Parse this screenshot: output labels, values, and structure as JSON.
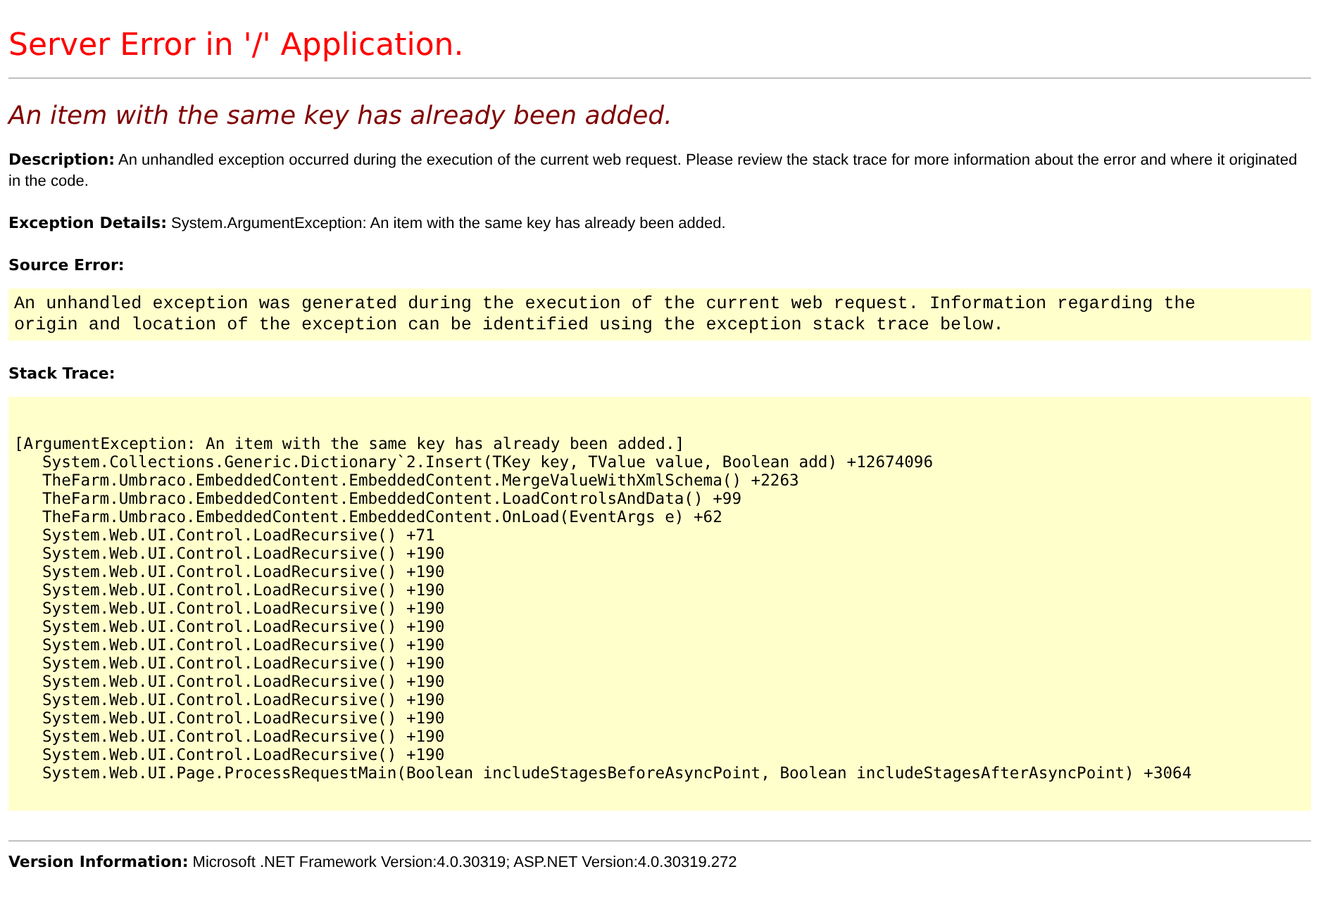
{
  "title": "Server Error in '/' Application.",
  "error_message": "An item with the same key has already been added.",
  "description": {
    "label": "Description:",
    "text": "An unhandled exception occurred during the execution of the current web request. Please review the stack trace for more information about the error and where it originated in the code."
  },
  "exception_details": {
    "label": "Exception Details:",
    "text": "System.ArgumentException: An item with the same key has already been added."
  },
  "source_error": {
    "label": "Source Error:",
    "lines": [
      "An unhandled exception was generated during the execution of the current web request. Information regarding the",
      "origin and location of the exception can be identified using the exception stack trace below."
    ]
  },
  "stack_trace": {
    "label": "Stack Trace:",
    "lines": [
      {
        "text": "[ArgumentException: An item with the same key has already been added.]",
        "indented": false
      },
      {
        "text": "System.Collections.Generic.Dictionary`2.Insert(TKey key, TValue value, Boolean add) +12674096",
        "indented": true
      },
      {
        "text": "TheFarm.Umbraco.EmbeddedContent.EmbeddedContent.MergeValueWithXmlSchema() +2263",
        "indented": true
      },
      {
        "text": "TheFarm.Umbraco.EmbeddedContent.EmbeddedContent.LoadControlsAndData() +99",
        "indented": true
      },
      {
        "text": "TheFarm.Umbraco.EmbeddedContent.EmbeddedContent.OnLoad(EventArgs e) +62",
        "indented": true
      },
      {
        "text": "System.Web.UI.Control.LoadRecursive() +71",
        "indented": true
      },
      {
        "text": "System.Web.UI.Control.LoadRecursive() +190",
        "indented": true
      },
      {
        "text": "System.Web.UI.Control.LoadRecursive() +190",
        "indented": true
      },
      {
        "text": "System.Web.UI.Control.LoadRecursive() +190",
        "indented": true
      },
      {
        "text": "System.Web.UI.Control.LoadRecursive() +190",
        "indented": true
      },
      {
        "text": "System.Web.UI.Control.LoadRecursive() +190",
        "indented": true
      },
      {
        "text": "System.Web.UI.Control.LoadRecursive() +190",
        "indented": true
      },
      {
        "text": "System.Web.UI.Control.LoadRecursive() +190",
        "indented": true
      },
      {
        "text": "System.Web.UI.Control.LoadRecursive() +190",
        "indented": true
      },
      {
        "text": "System.Web.UI.Control.LoadRecursive() +190",
        "indented": true
      },
      {
        "text": "System.Web.UI.Control.LoadRecursive() +190",
        "indented": true
      },
      {
        "text": "System.Web.UI.Control.LoadRecursive() +190",
        "indented": true
      },
      {
        "text": "System.Web.UI.Control.LoadRecursive() +190",
        "indented": true
      },
      {
        "text": "System.Web.UI.Page.ProcessRequestMain(Boolean includeStagesBeforeAsyncPoint, Boolean includeStagesAfterAsyncPoint) +3064",
        "indented": true
      }
    ]
  },
  "version_information": {
    "label": "Version Information:",
    "text": "Microsoft .NET Framework Version:4.0.30319; ASP.NET Version:4.0.30319.272"
  }
}
